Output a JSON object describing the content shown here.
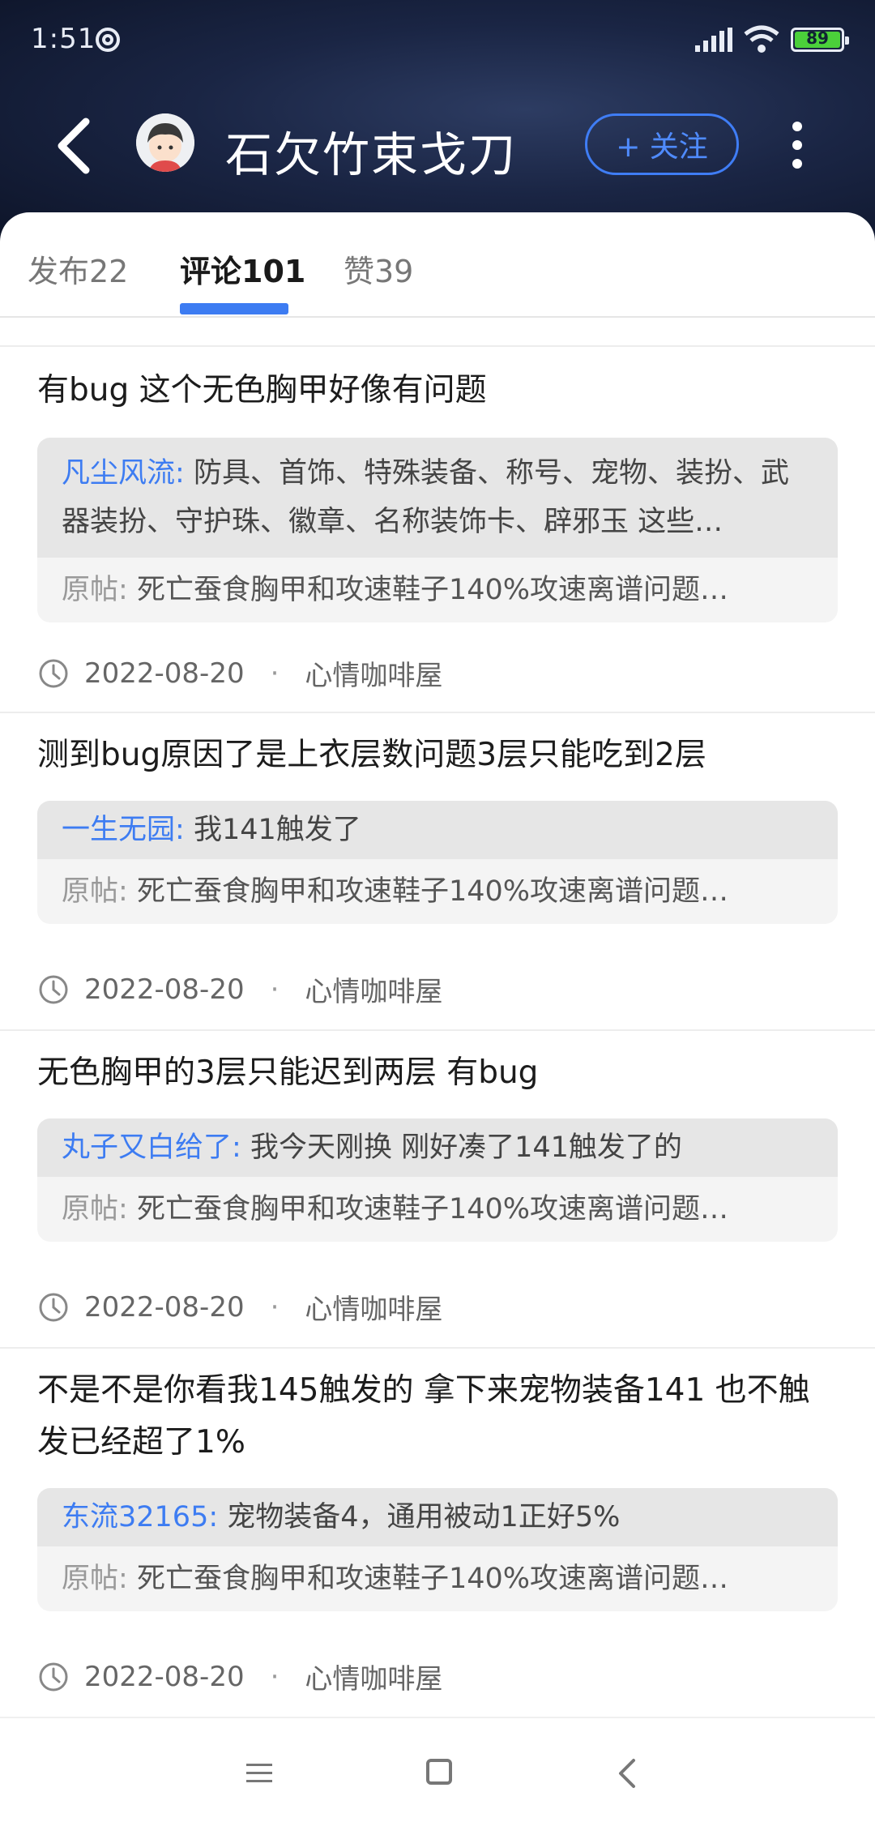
{
  "status": {
    "time": "1:51",
    "battery": "89"
  },
  "header": {
    "username": "石欠竹束戈刀",
    "follow_label": "+ 关注"
  },
  "tabs": [
    {
      "label": "发布22"
    },
    {
      "label": "评论101"
    },
    {
      "label": "赞39"
    }
  ],
  "items": [
    {
      "text": "有bug 这个无色胸甲好像有问题",
      "reply_user": "凡尘风流:",
      "reply_text": "防具、首饰、特殊装备、称号、宠物、装扮、武器装扮、守护珠、徽章、名称装饰卡、辟邪玉 这些…",
      "orig_label": "原帖:",
      "orig_text": "死亡蚕食胸甲和攻速鞋子140%攻速离谱问题…",
      "date": "2022-08-20",
      "forum": "心情咖啡屋"
    },
    {
      "text": "测到bug原因了是上衣层数问题3层只能吃到2层",
      "reply_user": "一生无园:",
      "reply_text": "我141触发了",
      "orig_label": "原帖:",
      "orig_text": "死亡蚕食胸甲和攻速鞋子140%攻速离谱问题…",
      "date": "2022-08-20",
      "forum": "心情咖啡屋"
    },
    {
      "text": "无色胸甲的3层只能迟到两层 有bug",
      "reply_user": "丸子又白给了:",
      "reply_text": "我今天刚换 刚好凑了141触发了的",
      "orig_label": "原帖:",
      "orig_text": "死亡蚕食胸甲和攻速鞋子140%攻速离谱问题…",
      "date": "2022-08-20",
      "forum": "心情咖啡屋"
    },
    {
      "text": "不是不是你看我145触发的 拿下来宠物装备141 也不触发已经超了1%",
      "reply_user": "东流32165:",
      "reply_text": "宠物装备4，通用被动1正好5%",
      "orig_label": "原帖:",
      "orig_text": "死亡蚕食胸甲和攻速鞋子140%攻速离谱问题…",
      "date": "2022-08-20",
      "forum": "心情咖啡屋"
    }
  ],
  "colors": {
    "accent": "#3d7cf2",
    "header_bg": "#1a2544"
  }
}
